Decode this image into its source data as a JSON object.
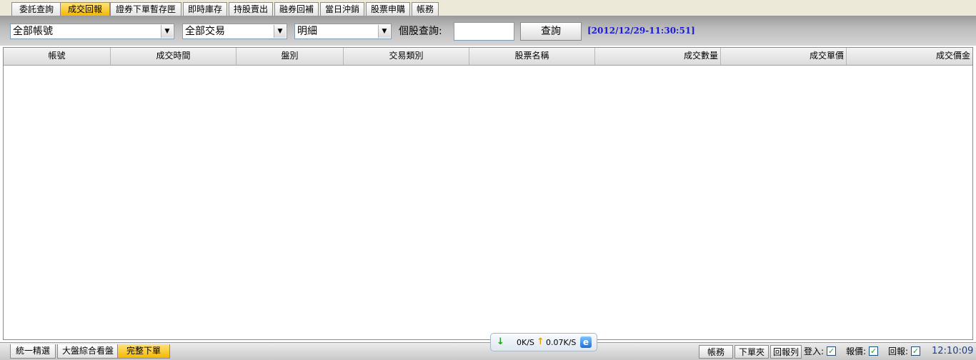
{
  "top_tabs": [
    {
      "label": "委託查詢",
      "active": false
    },
    {
      "label": "成交回報",
      "active": true
    },
    {
      "label": "證券下單暫存匣",
      "active": false
    },
    {
      "label": "即時庫存",
      "active": false
    },
    {
      "label": "持股賣出",
      "active": false
    },
    {
      "label": "融券回補",
      "active": false
    },
    {
      "label": "當日沖銷",
      "active": false
    },
    {
      "label": "股票申購",
      "active": false
    },
    {
      "label": "帳務",
      "active": false
    }
  ],
  "toolbar": {
    "account_select": "全部帳號",
    "trade_select": "全部交易",
    "detail_select": "明細",
    "stock_query_label": "個股查詢:",
    "stock_query_value": "",
    "query_button": "查詢",
    "timestamp": "[2012/12/29-11:30:51]"
  },
  "table": {
    "columns": [
      "帳號",
      "成交時間",
      "盤別",
      "交易類別",
      "股票名稱",
      "成交數量",
      "成交單價",
      "成交價金"
    ],
    "rows": []
  },
  "bottom_tabs": [
    {
      "label": "統一精選",
      "active": false
    },
    {
      "label": "大盤綜合看盤",
      "active": false
    },
    {
      "label": "完整下單",
      "active": true
    }
  ],
  "speed": {
    "down": "0K/S",
    "up": "0.07K/S"
  },
  "status": {
    "account_button": "帳務",
    "order_folder_button": "下單夾",
    "report_list_button": "回報列",
    "login_label": "登入:",
    "quote_label": "報價:",
    "report_label": "回報:",
    "login_checked": true,
    "quote_checked": true,
    "report_checked": true,
    "clock": "12:10:09"
  },
  "colors": {
    "active_tab": "#f5b800",
    "timestamp": "#1a1ad4",
    "check": "#21a121"
  }
}
